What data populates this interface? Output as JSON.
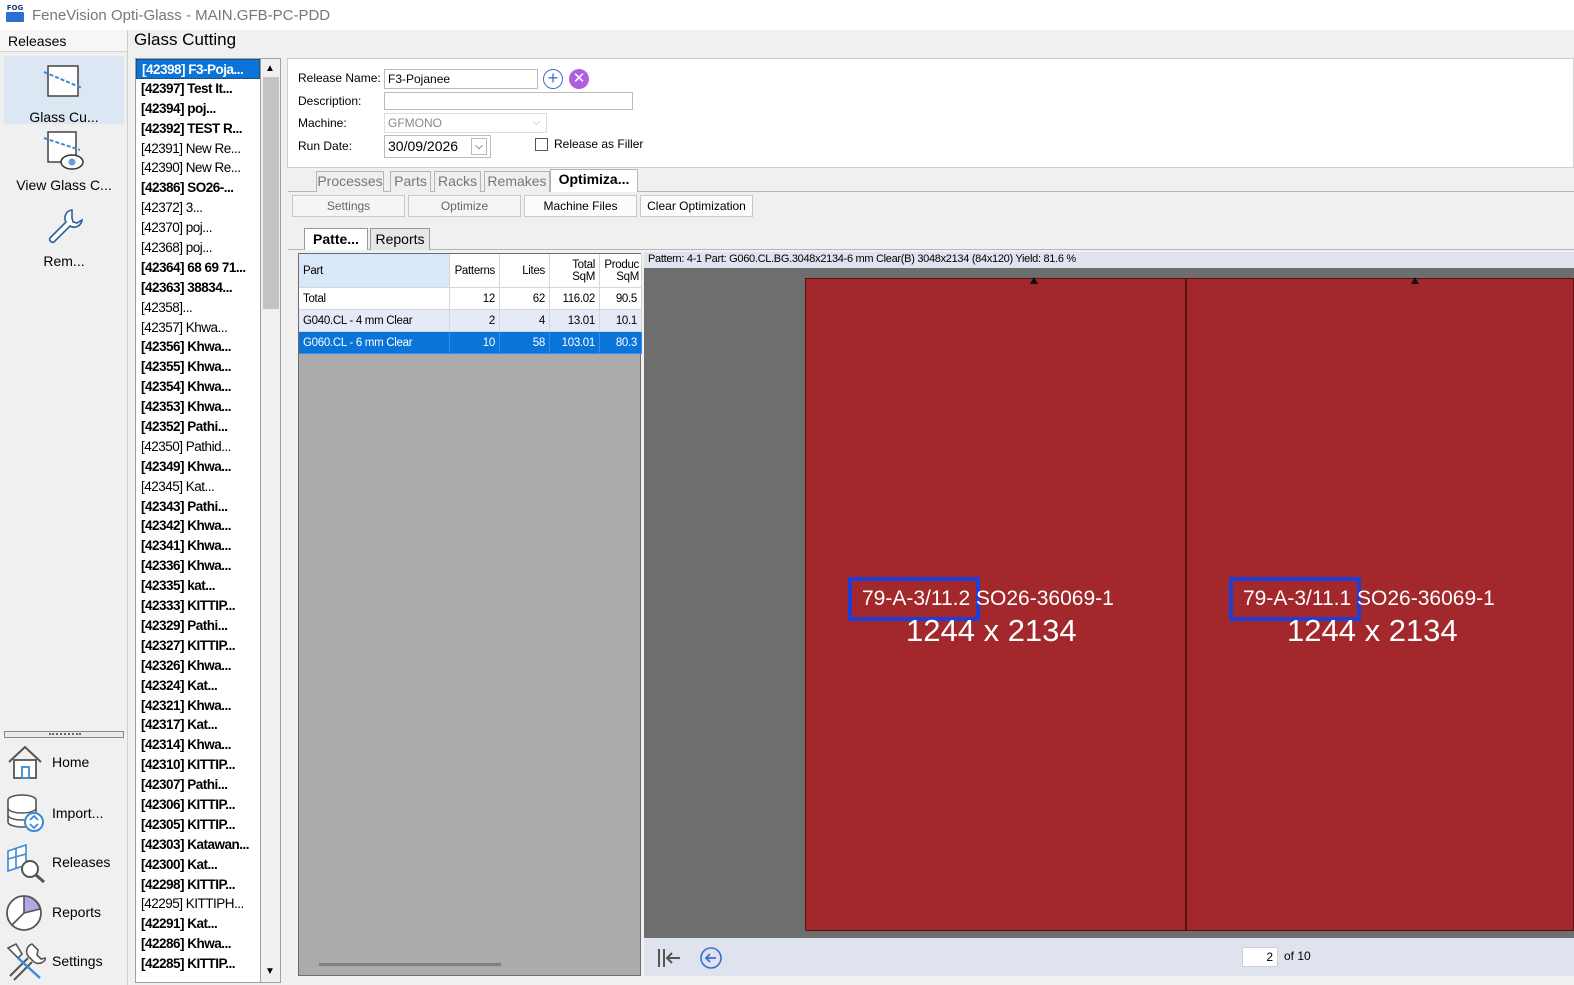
{
  "window": {
    "title": "FeneVision Opti-Glass - MAIN.GFB-PC-PDD",
    "logo_text": "FOG"
  },
  "nav": {
    "header": "Releases",
    "tools": [
      {
        "label": "Glass Cu...",
        "icon": "glass-cutting-icon"
      },
      {
        "label": "View Glass C...",
        "icon": "view-glass-icon"
      },
      {
        "label": "Rem...",
        "icon": "wrench-icon"
      }
    ],
    "buttons": [
      {
        "label": "Home",
        "icon": "home-icon"
      },
      {
        "label": "Import...",
        "icon": "database-import-icon"
      },
      {
        "label": "Releases",
        "icon": "releases-search-icon"
      },
      {
        "label": "Reports",
        "icon": "pie-chart-icon"
      },
      {
        "label": "Settings",
        "icon": "tools-icon"
      }
    ]
  },
  "module_title": "Glass Cutting",
  "releases": [
    {
      "text": "[42398] F3-Poja...",
      "bold": true,
      "selected": true
    },
    {
      "text": "[42397] Test It...",
      "bold": true
    },
    {
      "text": "[42394] poj...",
      "bold": true
    },
    {
      "text": "[42392] TEST R...",
      "bold": true
    },
    {
      "text": "[42391] New Re...",
      "bold": false
    },
    {
      "text": "[42390] New Re...",
      "bold": false
    },
    {
      "text": "[42386] SO26-...",
      "bold": true
    },
    {
      "text": "[42372] 3...",
      "bold": false
    },
    {
      "text": "[42370] poj...",
      "bold": false
    },
    {
      "text": "[42368] poj...",
      "bold": false
    },
    {
      "text": "[42364] 68 69 71...",
      "bold": true
    },
    {
      "text": "[42363] 38834...",
      "bold": true
    },
    {
      "text": "[42358]...",
      "bold": false
    },
    {
      "text": "[42357] Khwa...",
      "bold": false
    },
    {
      "text": "[42356] Khwa...",
      "bold": true
    },
    {
      "text": "[42355] Khwa...",
      "bold": true
    },
    {
      "text": "[42354] Khwa...",
      "bold": true
    },
    {
      "text": "[42353] Khwa...",
      "bold": true
    },
    {
      "text": "[42352] Pathi...",
      "bold": true
    },
    {
      "text": "[42350] Pathid...",
      "bold": false
    },
    {
      "text": "[42349] Khwa...",
      "bold": true
    },
    {
      "text": "[42345] Kat...",
      "bold": false
    },
    {
      "text": "[42343] Pathi...",
      "bold": true
    },
    {
      "text": "[42342] Khwa...",
      "bold": true
    },
    {
      "text": "[42341] Khwa...",
      "bold": true
    },
    {
      "text": "[42336] Khwa...",
      "bold": true
    },
    {
      "text": "[42335] kat...",
      "bold": true
    },
    {
      "text": "[42333] KITTIP...",
      "bold": true
    },
    {
      "text": "[42329] Pathi...",
      "bold": true
    },
    {
      "text": "[42327] KITTIP...",
      "bold": true
    },
    {
      "text": "[42326] Khwa...",
      "bold": true
    },
    {
      "text": "[42324] Kat...",
      "bold": true
    },
    {
      "text": "[42321] Khwa...",
      "bold": true
    },
    {
      "text": "[42317] Kat...",
      "bold": true
    },
    {
      "text": "[42314] Khwa...",
      "bold": true
    },
    {
      "text": "[42310] KITTIP...",
      "bold": true
    },
    {
      "text": "[42307] Pathi...",
      "bold": true
    },
    {
      "text": "[42306] KITTIP...",
      "bold": true
    },
    {
      "text": "[42305] KITTIP...",
      "bold": true
    },
    {
      "text": "[42303] Katawan...",
      "bold": true
    },
    {
      "text": "[42300] Kat...",
      "bold": true
    },
    {
      "text": "[42298] KITTIP...",
      "bold": true
    },
    {
      "text": "[42295] KITTIPH...",
      "bold": false
    },
    {
      "text": "[42291] Kat...",
      "bold": true
    },
    {
      "text": "[42286] Khwa...",
      "bold": true
    },
    {
      "text": "[42285] KITTIP...",
      "bold": true
    }
  ],
  "form": {
    "release_name_label": "Release Name:",
    "release_name_value": "F3-Pojanee",
    "description_label": "Description:",
    "description_value": "",
    "machine_label": "Machine:",
    "machine_value": "GFMONO",
    "run_date_label": "Run Date:",
    "run_date_value": "30/09/2026",
    "filler_label": "Release as Filler",
    "filler_checked": false
  },
  "tabs": [
    "Processes",
    "Parts",
    "Racks",
    "Remakes",
    "Optimiza..."
  ],
  "active_tab": "Optimiza...",
  "toolbar": [
    "Settings",
    "Optimize",
    "Machine Files",
    "Clear Optimization"
  ],
  "subtabs": [
    "Patte...",
    "Reports"
  ],
  "grid": {
    "columns": [
      "Part",
      "Patterns",
      "Lites",
      "Total SqM",
      "Produc SqM"
    ],
    "rows": [
      {
        "part": "Total",
        "patterns": "12",
        "lites": "62",
        "total_sqm": "116.02",
        "prod_sqm": "90.5"
      },
      {
        "part": "G040.CL - 4 mm Clear",
        "patterns": "2",
        "lites": "4",
        "total_sqm": "13.01",
        "prod_sqm": "10.1"
      },
      {
        "part": "G060.CL - 6 mm Clear",
        "patterns": "10",
        "lites": "58",
        "total_sqm": "103.01",
        "prod_sqm": "80.3"
      }
    ],
    "selected_row": 2
  },
  "preview": {
    "info": "Pattern: 4-1   Part: G060.CL.BG.3048x2134-6 mm Clear(B) 3048x2134 (84x120)   Yield: 81.6 %",
    "panes": [
      {
        "id_boxed": "79-A-3/11.2",
        "id_rest": "SO26-36069-1",
        "dim": "1244 x 2134"
      },
      {
        "id_boxed": "79-A-3/11.1",
        "id_rest": "SO26-36069-1",
        "dim": "1244 x 2134"
      }
    ],
    "page_value": "2",
    "page_total": "of 10",
    "glass_color": "#a2282b",
    "highlight_color": "#1e3ed8"
  }
}
